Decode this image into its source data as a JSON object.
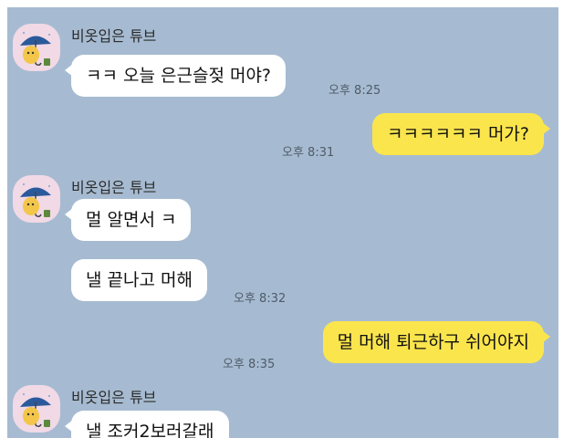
{
  "chat": {
    "messages": [
      {
        "sender": "비옷입은 튜브",
        "text": "ㅋㅋ 오늘 은근슬젖 머야?",
        "time": "오후 8:25"
      },
      {
        "text": "ㅋㅋㅋㅋㅋㅋ 머가?",
        "time": "오후 8:31"
      },
      {
        "sender": "비옷입은 튜브",
        "text": "멀 알면서 ㅋ"
      },
      {
        "text": "낼 끝나고 머해",
        "time": "오후 8:32"
      },
      {
        "text": "멀 머해 퇴근하구 쉬어야지",
        "time": "오후 8:35"
      },
      {
        "sender": "비옷입은 튜브",
        "text": "낼 조커2보러갈래"
      }
    ]
  },
  "colors": {
    "chat_background": "#a6bbd1",
    "incoming_bubble": "#ffffff",
    "outgoing_bubble": "#fbe54d",
    "avatar_background": "#f1d9e6"
  },
  "icons": {
    "avatar": "tube-character-with-umbrella-icon"
  }
}
